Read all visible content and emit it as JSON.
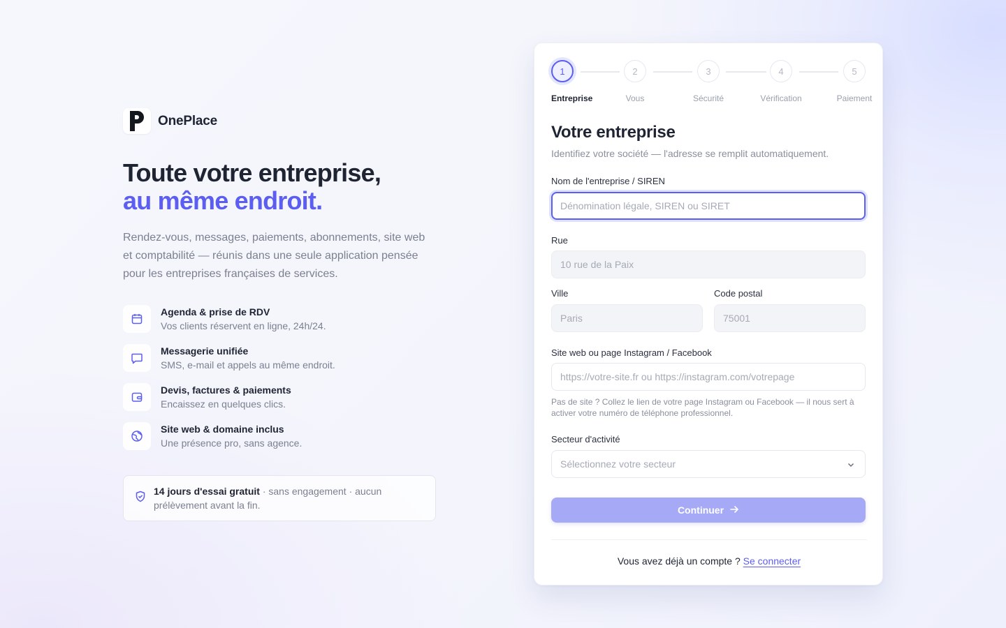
{
  "brand": {
    "name": "OnePlace",
    "logo_icon": "oneplace-p-logo"
  },
  "hero": {
    "title_line1": "Toute votre entreprise,",
    "title_line2": "au même endroit.",
    "description": "Rendez-vous, messages, paiements, abonnements, site web et comptabilité — réunis dans une seule application pensée pour les entreprises françaises de services."
  },
  "features": [
    {
      "icon": "calendar-icon",
      "title": "Agenda & prise de RDV",
      "desc": "Vos clients réservent en ligne, 24h/24."
    },
    {
      "icon": "chat-icon",
      "title": "Messagerie unifiée",
      "desc": "SMS, e-mail et appels au même endroit."
    },
    {
      "icon": "wallet-icon",
      "title": "Devis, factures & paiements",
      "desc": "Encaissez en quelques clics."
    },
    {
      "icon": "globe-icon",
      "title": "Site web & domaine inclus",
      "desc": "Une présence pro, sans agence."
    }
  ],
  "trial": {
    "bold": "14 jours d'essai gratuit",
    "rest": " · sans engagement · aucun prélèvement avant la fin."
  },
  "stepper": {
    "active_step": 1,
    "steps": [
      {
        "number": "1",
        "label": "Entreprise"
      },
      {
        "number": "2",
        "label": "Vous"
      },
      {
        "number": "3",
        "label": "Sécurité"
      },
      {
        "number": "4",
        "label": "Vérification"
      },
      {
        "number": "5",
        "label": "Paiement"
      }
    ]
  },
  "form": {
    "title": "Votre entreprise",
    "subtitle": "Identifiez votre société — l'adresse se remplit automatiquement.",
    "company": {
      "label": "Nom de l'entreprise / SIREN",
      "placeholder": "Dénomination légale, SIREN ou SIRET"
    },
    "street": {
      "label": "Rue",
      "placeholder": "10 rue de la Paix"
    },
    "city": {
      "label": "Ville",
      "placeholder": "Paris"
    },
    "postal": {
      "label": "Code postal",
      "placeholder": "75001"
    },
    "website": {
      "label": "Site web ou page Instagram / Facebook",
      "placeholder": "https://votre-site.fr ou https://instagram.com/votrepage",
      "hint": "Pas de site ? Collez le lien de votre page Instagram ou Facebook — il nous sert à activer votre numéro de téléphone professionnel."
    },
    "sector": {
      "label": "Secteur d'activité",
      "placeholder": "Sélectionnez votre secteur"
    },
    "submit_label": "Continuer",
    "footer_text": "Vous avez déjà un compte ?",
    "footer_link": "Se connecter"
  },
  "colors": {
    "accent": "#5b5ef0",
    "button_disabled": "#a6a9f6"
  }
}
